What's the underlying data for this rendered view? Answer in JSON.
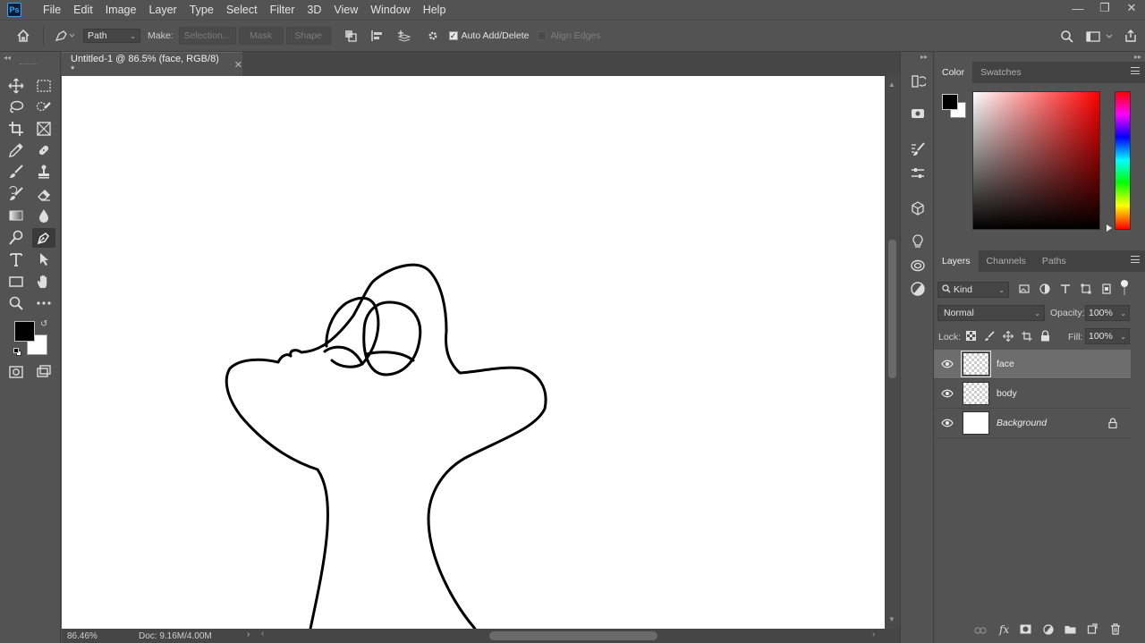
{
  "app": {
    "logo": "Ps"
  },
  "menu": [
    "File",
    "Edit",
    "Image",
    "Layer",
    "Type",
    "Select",
    "Filter",
    "3D",
    "View",
    "Window",
    "Help"
  ],
  "window_controls": {
    "minimize": "—",
    "restore": "❐",
    "close": "✕"
  },
  "options": {
    "pen_mode": "Path",
    "make_label": "Make:",
    "selection_btn": "Selection...",
    "mask_btn": "Mask",
    "shape_btn": "Shape",
    "auto_add_delete": "Auto Add/Delete",
    "align_edges": "Align Edges"
  },
  "document": {
    "tab_title": "Untitled-1 @ 86.5% (face, RGB/8) *",
    "zoom": "86.46%",
    "doc_size": "Doc: 9.16M/4.00M"
  },
  "color_panel": {
    "tabs": [
      "Color",
      "Swatches"
    ],
    "foreground": "#000000",
    "background": "#ffffff"
  },
  "layers_panel": {
    "tabs": [
      "Layers",
      "Channels",
      "Paths"
    ],
    "filter_kind": "Kind",
    "blend_mode": "Normal",
    "opacity_label": "Opacity:",
    "opacity": "100%",
    "lock_label": "Lock:",
    "fill_label": "Fill:",
    "fill": "100%",
    "layers": [
      {
        "name": "face",
        "selected": true
      },
      {
        "name": "body",
        "selected": false
      },
      {
        "name": "Background",
        "selected": false,
        "locked": true
      }
    ]
  },
  "colors": {
    "accent": "#31a8ff",
    "ui_bg": "#535353",
    "selected_layer": "#6d6d6d"
  }
}
